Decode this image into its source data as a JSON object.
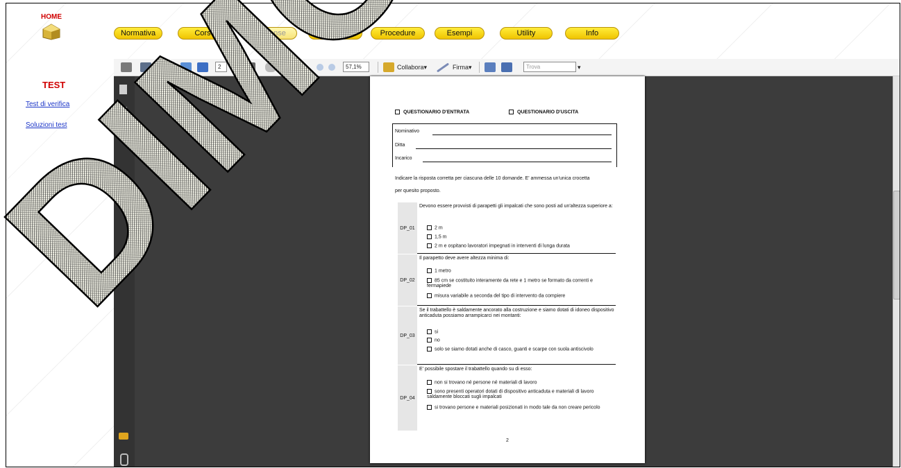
{
  "home": {
    "label": "HOME"
  },
  "nav": {
    "items": [
      "Normativa",
      "Corso",
      "Dispense",
      "Test",
      "Procedure",
      "Esempi",
      "Utility",
      "Info"
    ]
  },
  "left": {
    "title": "TEST",
    "links": [
      "Test di verifica",
      "Soluzioni test"
    ]
  },
  "toolbar": {
    "page_current": "2",
    "page_total": "/ 3",
    "zoom": "57,1%",
    "collabora": "Collabora",
    "firma": "Firma",
    "search_placeholder": "Trova"
  },
  "watermark": {
    "text": "DIMOS"
  },
  "doc": {
    "q_entrata": "QUESTIONARIO D'ENTRATA",
    "q_uscita": "QUESTIONARIO D'USCITA",
    "fields": [
      "Nominativo",
      "Ditta",
      "Incarico"
    ],
    "instruction_1": "Indicare la risposta corretta per ciascuna delle 10 domande. E' ammessa un'unica crocetta",
    "instruction_2": "per quesito proposto.",
    "questions": [
      {
        "id": "DP_01",
        "text": "Devono essere provvisti di parapetti gli impalcati che sono posti ad un'altezza superiore a:",
        "options": [
          "2 m",
          "1,5 m",
          "2 m e ospitano lavoratori impegnati in interventi di lunga durata"
        ]
      },
      {
        "id": "DP_02",
        "text": "Il parapetto deve avere altezza minima di:",
        "options": [
          "1 metro",
          "85 cm se costituito interamente da rete e 1 metro se formato da correnti e fermapiede",
          "misura variabile a seconda del tipo di intervento da compiere"
        ]
      },
      {
        "id": "DP_03",
        "text": "Se il trabattello è saldamente ancorato alla costruzione e siamo dotati di idoneo dispositivo anticaduta possiamo arrampicarci nei montanti:",
        "options": [
          "si",
          "no",
          "solo se siamo dotati anche di casco, guanti  e scarpe con suola antiscivolo"
        ]
      },
      {
        "id": "DP_04",
        "text": "E' possibile spostare il trabattello quando su di esso:",
        "options": [
          "non si trovano né persone né materiali di lavoro",
          "sono presenti operatori dotati di dispositivo anticaduta e materiali di lavoro saldamente bloccati sugli impalcati",
          "si trovano persone e materiali posizionati in modo tale da non creare pericolo"
        ]
      }
    ],
    "page_number": "2"
  }
}
